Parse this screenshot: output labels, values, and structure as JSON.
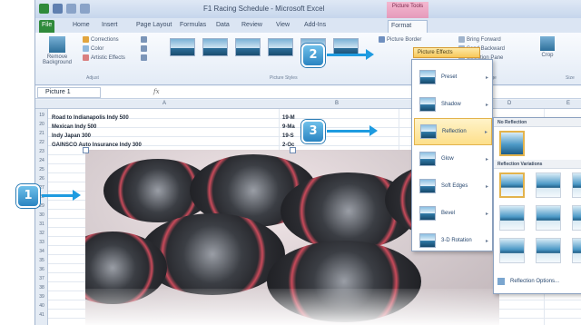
{
  "window": {
    "title": "F1 Racing Schedule - Microsoft Excel",
    "contextual_tab_group": "Picture Tools"
  },
  "tabs": [
    "File",
    "Home",
    "Insert",
    "Page Layout",
    "Formulas",
    "Data",
    "Review",
    "View",
    "Add-Ins",
    "Format"
  ],
  "ribbon": {
    "remove_background": "Remove Background",
    "corrections": "Corrections",
    "color": "Color",
    "artistic_effects": "Artistic Effects",
    "adjust_group": "Adjust",
    "picture_styles_group": "Picture Styles",
    "picture_border": "Picture Border",
    "picture_effects": "Picture Effects",
    "bring_forward": "Bring Forward",
    "send_backward": "Send Backward",
    "selection_pane": "Selection Pane",
    "arrange_group": "Arrange",
    "crop": "Crop",
    "size_group": "Size"
  },
  "formula_bar": {
    "name_box": "Picture 1",
    "fx": "fx"
  },
  "columns": [
    "A",
    "B",
    "C",
    "D",
    "E"
  ],
  "rows": [
    "19",
    "20",
    "21",
    "22",
    "23",
    "24",
    "25",
    "26",
    "27",
    "28",
    "29",
    "30",
    "31",
    "32",
    "33",
    "34",
    "35",
    "36",
    "37",
    "38",
    "39",
    "40",
    "41"
  ],
  "cells": [
    {
      "a": "Road to Indianapolis Indy 500",
      "b": "19-M"
    },
    {
      "a": "Mexican Indy 500",
      "b": "9-Ma"
    },
    {
      "a": "Indy Japan 300",
      "b": "19-S"
    },
    {
      "a": "GAINSCO Auto Insurance Indy 300",
      "b": "2-Oc"
    }
  ],
  "effects_menu": {
    "items": [
      "Preset",
      "Shadow",
      "Reflection",
      "Glow",
      "Soft Edges",
      "Bevel",
      "3-D Rotation"
    ],
    "highlighted": "Reflection"
  },
  "reflection_menu": {
    "no_reflection": "No Reflection",
    "variations": "Reflection Variations",
    "options": "Reflection Options..."
  },
  "callouts": [
    "1",
    "2",
    "3"
  ],
  "colors": {
    "accent": "#1e9be0",
    "file_tab": "#2f8a3b",
    "highlight": "#fddf8a"
  }
}
